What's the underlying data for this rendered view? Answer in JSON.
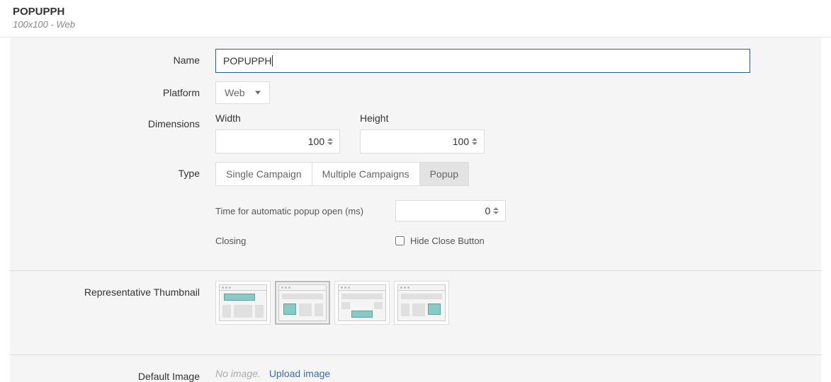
{
  "header": {
    "title": "POPUPPH",
    "subtitle": "100x100 - Web"
  },
  "form": {
    "name_label": "Name",
    "name_value": "POPUPPH",
    "platform_label": "Platform",
    "platform_value": "Web",
    "dimensions_label": "Dimensions",
    "width_label": "Width",
    "width_value": "100",
    "height_label": "Height",
    "height_value": "100",
    "type_label": "Type",
    "type_options": [
      "Single Campaign",
      "Multiple Campaigns",
      "Popup"
    ],
    "type_selected": "Popup",
    "popup_time_label": "Time for automatic popup open (ms)",
    "popup_time_value": "0",
    "closing_label": "Closing",
    "hide_close_label": "Hide Close Button",
    "hide_close_checked": false,
    "thumbnail_label": "Representative Thumbnail",
    "default_image_label": "Default Image",
    "no_image_text": "No image.",
    "upload_image_text": "Upload image"
  }
}
